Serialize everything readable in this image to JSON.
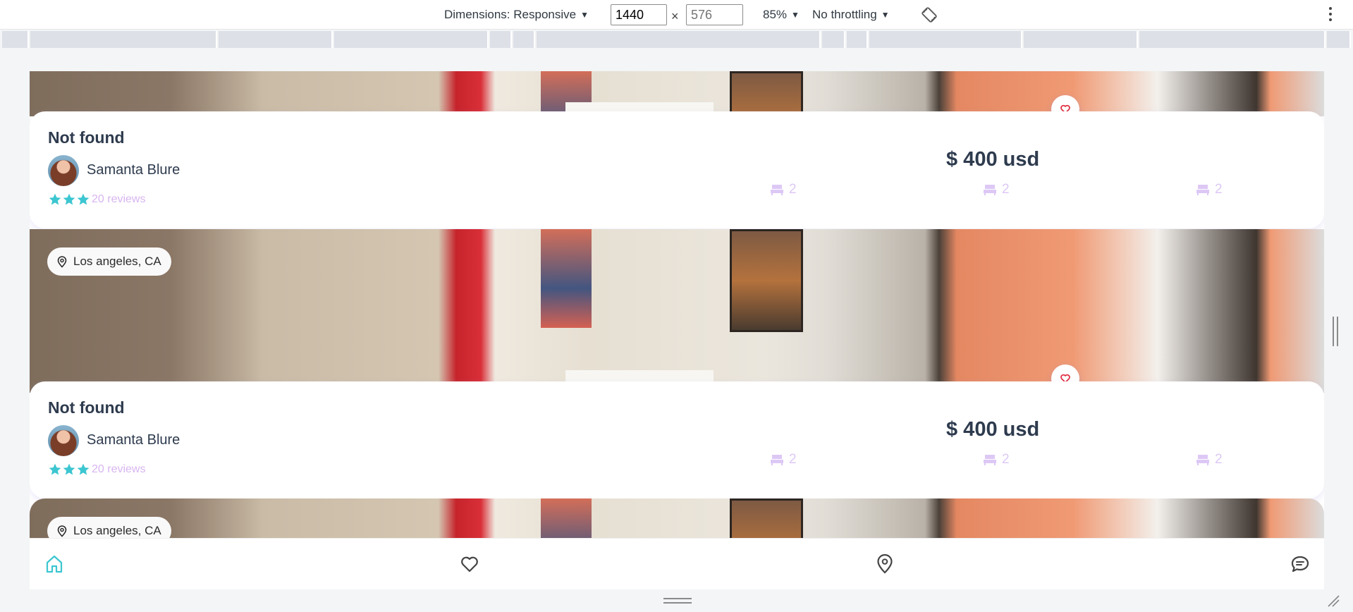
{
  "devtools": {
    "dimensions_label": "Dimensions: Responsive",
    "width_value": "1440",
    "height_placeholder": "576",
    "times": "×",
    "zoom": "85%",
    "throttling": "No throttling",
    "caret": "▼"
  },
  "cards": [
    {
      "location": "",
      "title": "Not found",
      "host": "Samanta Blure",
      "reviews": "20 reviews",
      "price": "$ 400 usd",
      "features": [
        "2",
        "2",
        "2"
      ]
    },
    {
      "location": "Los angeles, CA",
      "title": "Not found",
      "host": "Samanta Blure",
      "reviews": "20 reviews",
      "price": "$ 400 usd",
      "features": [
        "2",
        "2",
        "2"
      ]
    },
    {
      "location": "Los angeles, CA"
    }
  ],
  "nav": {
    "items": [
      "home-icon",
      "heart-icon",
      "map-pin-icon",
      "chat-icon"
    ]
  },
  "colors": {
    "accent": "#3cc6d1",
    "title": "#2e3b4e",
    "feature": "#ddc8f5",
    "heart": "#e0283c"
  }
}
